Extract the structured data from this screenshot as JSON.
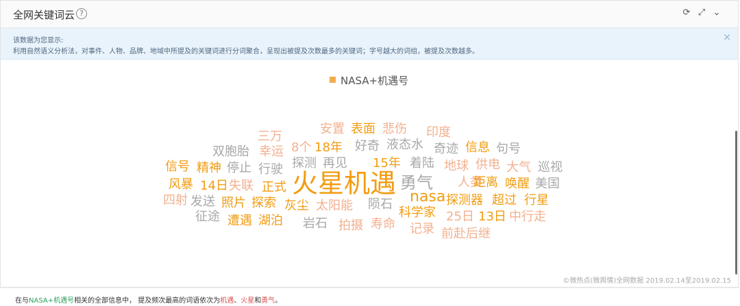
{
  "header": {
    "title": "全网关键词云",
    "help_icon": "question-circle-icon",
    "tools": [
      {
        "name": "refresh-icon",
        "glyph": "⟳"
      },
      {
        "name": "expand-icon",
        "glyph": "⤢"
      },
      {
        "name": "chevron-down-icon",
        "glyph": "⌄"
      }
    ]
  },
  "info": {
    "line1": "该数据为您显示:",
    "line2": "利用自然语义分析法，对事件、人物、品牌、地域中所提及的关键词进行分词聚合，呈现出被提及次数最多的关键词；字号越大的词组，被提及次数越多。",
    "close": "×"
  },
  "legend": {
    "label": "NASA+机遇号",
    "color": "#f0ad4e"
  },
  "cloud": {
    "colors": {
      "orange": "#f29c11",
      "peach": "#f3b08f",
      "gray": "#a8a8a8"
    },
    "words": [
      {
        "text": "火星机遇",
        "size": 38,
        "color": "orange"
      },
      {
        "text": "勇气",
        "size": 24,
        "color": "gray"
      },
      {
        "text": "nasa",
        "size": 22,
        "color": "orange"
      },
      {
        "text": "三万",
        "size": 18,
        "color": "peach"
      },
      {
        "text": "安置",
        "size": 18,
        "color": "peach"
      },
      {
        "text": "表面",
        "size": 18,
        "color": "orange"
      },
      {
        "text": "悲伤",
        "size": 18,
        "color": "peach"
      },
      {
        "text": "印度",
        "size": 18,
        "color": "peach"
      },
      {
        "text": "双胞胎",
        "size": 18,
        "color": "gray"
      },
      {
        "text": "幸运",
        "size": 18,
        "color": "peach"
      },
      {
        "text": "8个",
        "size": 18,
        "color": "peach"
      },
      {
        "text": "18年",
        "size": 18,
        "color": "orange"
      },
      {
        "text": "好奇",
        "size": 18,
        "color": "gray"
      },
      {
        "text": "液态水",
        "size": 18,
        "color": "gray"
      },
      {
        "text": "奇迹",
        "size": 18,
        "color": "gray"
      },
      {
        "text": "信息",
        "size": 18,
        "color": "orange"
      },
      {
        "text": "句号",
        "size": 18,
        "color": "gray"
      },
      {
        "text": "信号",
        "size": 18,
        "color": "orange"
      },
      {
        "text": "精神",
        "size": 18,
        "color": "orange"
      },
      {
        "text": "停止",
        "size": 18,
        "color": "gray"
      },
      {
        "text": "行驶",
        "size": 18,
        "color": "gray"
      },
      {
        "text": "探测",
        "size": 18,
        "color": "gray"
      },
      {
        "text": "再见",
        "size": 18,
        "color": "gray"
      },
      {
        "text": "15年",
        "size": 18,
        "color": "orange"
      },
      {
        "text": "着陆",
        "size": 18,
        "color": "gray"
      },
      {
        "text": "地球",
        "size": 18,
        "color": "peach"
      },
      {
        "text": "供电",
        "size": 18,
        "color": "peach"
      },
      {
        "text": "大气",
        "size": 18,
        "color": "peach"
      },
      {
        "text": "巡视",
        "size": 18,
        "color": "gray"
      },
      {
        "text": "风暴",
        "size": 18,
        "color": "orange"
      },
      {
        "text": "14日",
        "size": 18,
        "color": "orange"
      },
      {
        "text": "失联",
        "size": 18,
        "color": "peach"
      },
      {
        "text": "正式",
        "size": 18,
        "color": "orange"
      },
      {
        "text": "人类",
        "size": 18,
        "color": "peach"
      },
      {
        "text": "距离",
        "size": 18,
        "color": "orange"
      },
      {
        "text": "唤醒",
        "size": 18,
        "color": "orange"
      },
      {
        "text": "美国",
        "size": 18,
        "color": "gray"
      },
      {
        "text": "四射",
        "size": 18,
        "color": "peach"
      },
      {
        "text": "发送",
        "size": 18,
        "color": "gray"
      },
      {
        "text": "照片",
        "size": 18,
        "color": "orange"
      },
      {
        "text": "探索",
        "size": 18,
        "color": "orange"
      },
      {
        "text": "灰尘",
        "size": 18,
        "color": "orange"
      },
      {
        "text": "太阳能",
        "size": 18,
        "color": "peach"
      },
      {
        "text": "陨石",
        "size": 18,
        "color": "gray"
      },
      {
        "text": "探测器",
        "size": 18,
        "color": "orange"
      },
      {
        "text": "超过",
        "size": 18,
        "color": "orange"
      },
      {
        "text": "行星",
        "size": 18,
        "color": "orange"
      },
      {
        "text": "征途",
        "size": 18,
        "color": "gray"
      },
      {
        "text": "遭遇",
        "size": 18,
        "color": "orange"
      },
      {
        "text": "湖泊",
        "size": 18,
        "color": "orange"
      },
      {
        "text": "岩石",
        "size": 18,
        "color": "gray"
      },
      {
        "text": "科学家",
        "size": 18,
        "color": "orange"
      },
      {
        "text": "25日",
        "size": 18,
        "color": "peach"
      },
      {
        "text": "13日",
        "size": 18,
        "color": "orange"
      },
      {
        "text": "中行走",
        "size": 18,
        "color": "peach"
      },
      {
        "text": "拍摄",
        "size": 18,
        "color": "peach"
      },
      {
        "text": "寿命",
        "size": 18,
        "color": "peach"
      },
      {
        "text": "记录",
        "size": 18,
        "color": "peach"
      },
      {
        "text": "前赴后继",
        "size": 18,
        "color": "peach"
      }
    ]
  },
  "credit": "©微热点(微舆情)全网数据 2019.02.14至2019.02.15",
  "footer": {
    "prefix": "在与",
    "subject": "NASA+机遇号",
    "middle": "相关的全部信息中，  提及频次最高的词语依次为",
    "w1": "机遇",
    "sep1": "、",
    "w2": "火星",
    "sep2": "和",
    "w3": "勇气",
    "end": "。"
  }
}
